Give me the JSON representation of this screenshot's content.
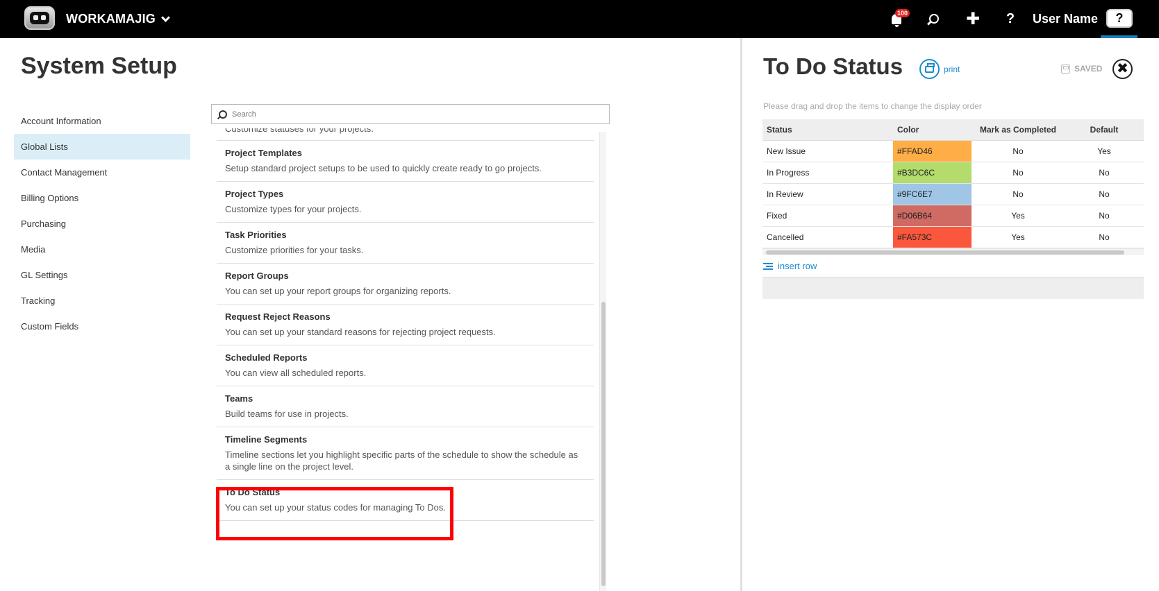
{
  "topbar": {
    "brand": "WORKAMAJIG",
    "notification_count": "100",
    "plus_glyph": "✚",
    "help_glyph": "?",
    "user_name": "User Name",
    "help_box_glyph": "?"
  },
  "page": {
    "title": "System Setup"
  },
  "sidebar": {
    "items": [
      {
        "label": "Account Information",
        "active": false
      },
      {
        "label": "Global Lists",
        "active": true
      },
      {
        "label": "Contact Management",
        "active": false
      },
      {
        "label": "Billing Options",
        "active": false
      },
      {
        "label": "Purchasing",
        "active": false
      },
      {
        "label": "Media",
        "active": false
      },
      {
        "label": "GL Settings",
        "active": false
      },
      {
        "label": "Tracking",
        "active": false
      },
      {
        "label": "Custom Fields",
        "active": false
      }
    ]
  },
  "search": {
    "placeholder": "Search"
  },
  "list": {
    "partial_desc": "Customize statuses for your projects.",
    "items": [
      {
        "title": "Project Templates",
        "desc": "Setup standard project setups to be used to quickly create ready to go projects."
      },
      {
        "title": "Project Types",
        "desc": "Customize types for your projects."
      },
      {
        "title": "Task Priorities",
        "desc": "Customize priorities for your tasks."
      },
      {
        "title": "Report Groups",
        "desc": "You can set up your report groups for organizing reports."
      },
      {
        "title": "Request Reject Reasons",
        "desc": "You can set up your standard reasons for rejecting project requests."
      },
      {
        "title": "Scheduled Reports",
        "desc": "You can view all scheduled reports."
      },
      {
        "title": "Teams",
        "desc": "Build teams for use in projects."
      },
      {
        "title": "Timeline Segments",
        "desc": "Timeline sections let you highlight specific parts of the schedule to show the schedule as a single line on the project level."
      },
      {
        "title": "To Do Status",
        "desc": "You can set up your status codes for managing To Dos."
      }
    ]
  },
  "panel": {
    "title": "To Do Status",
    "print_label": "print",
    "saved_label": "SAVED",
    "close_glyph": "✖",
    "hint": "Please drag and drop the items to change the display order",
    "insert_row_label": "insert row",
    "table": {
      "headers": [
        "Status",
        "Color",
        "Mark as Completed",
        "Default"
      ],
      "rows": [
        {
          "status": "New Issue",
          "color": "#FFAD46",
          "completed": "No",
          "default": "Yes"
        },
        {
          "status": "In Progress",
          "color": "#B3DC6C",
          "completed": "No",
          "default": "No"
        },
        {
          "status": "In Review",
          "color": "#9FC6E7",
          "completed": "No",
          "default": "No"
        },
        {
          "status": "Fixed",
          "color": "#D06B64",
          "completed": "Yes",
          "default": "No"
        },
        {
          "status": "Cancelled",
          "color": "#FA573C",
          "completed": "Yes",
          "default": "No"
        }
      ]
    }
  },
  "colors": {
    "accent": "#1a8ccf",
    "active_nav": "#dbeef8",
    "highlight": "#ff0000"
  }
}
